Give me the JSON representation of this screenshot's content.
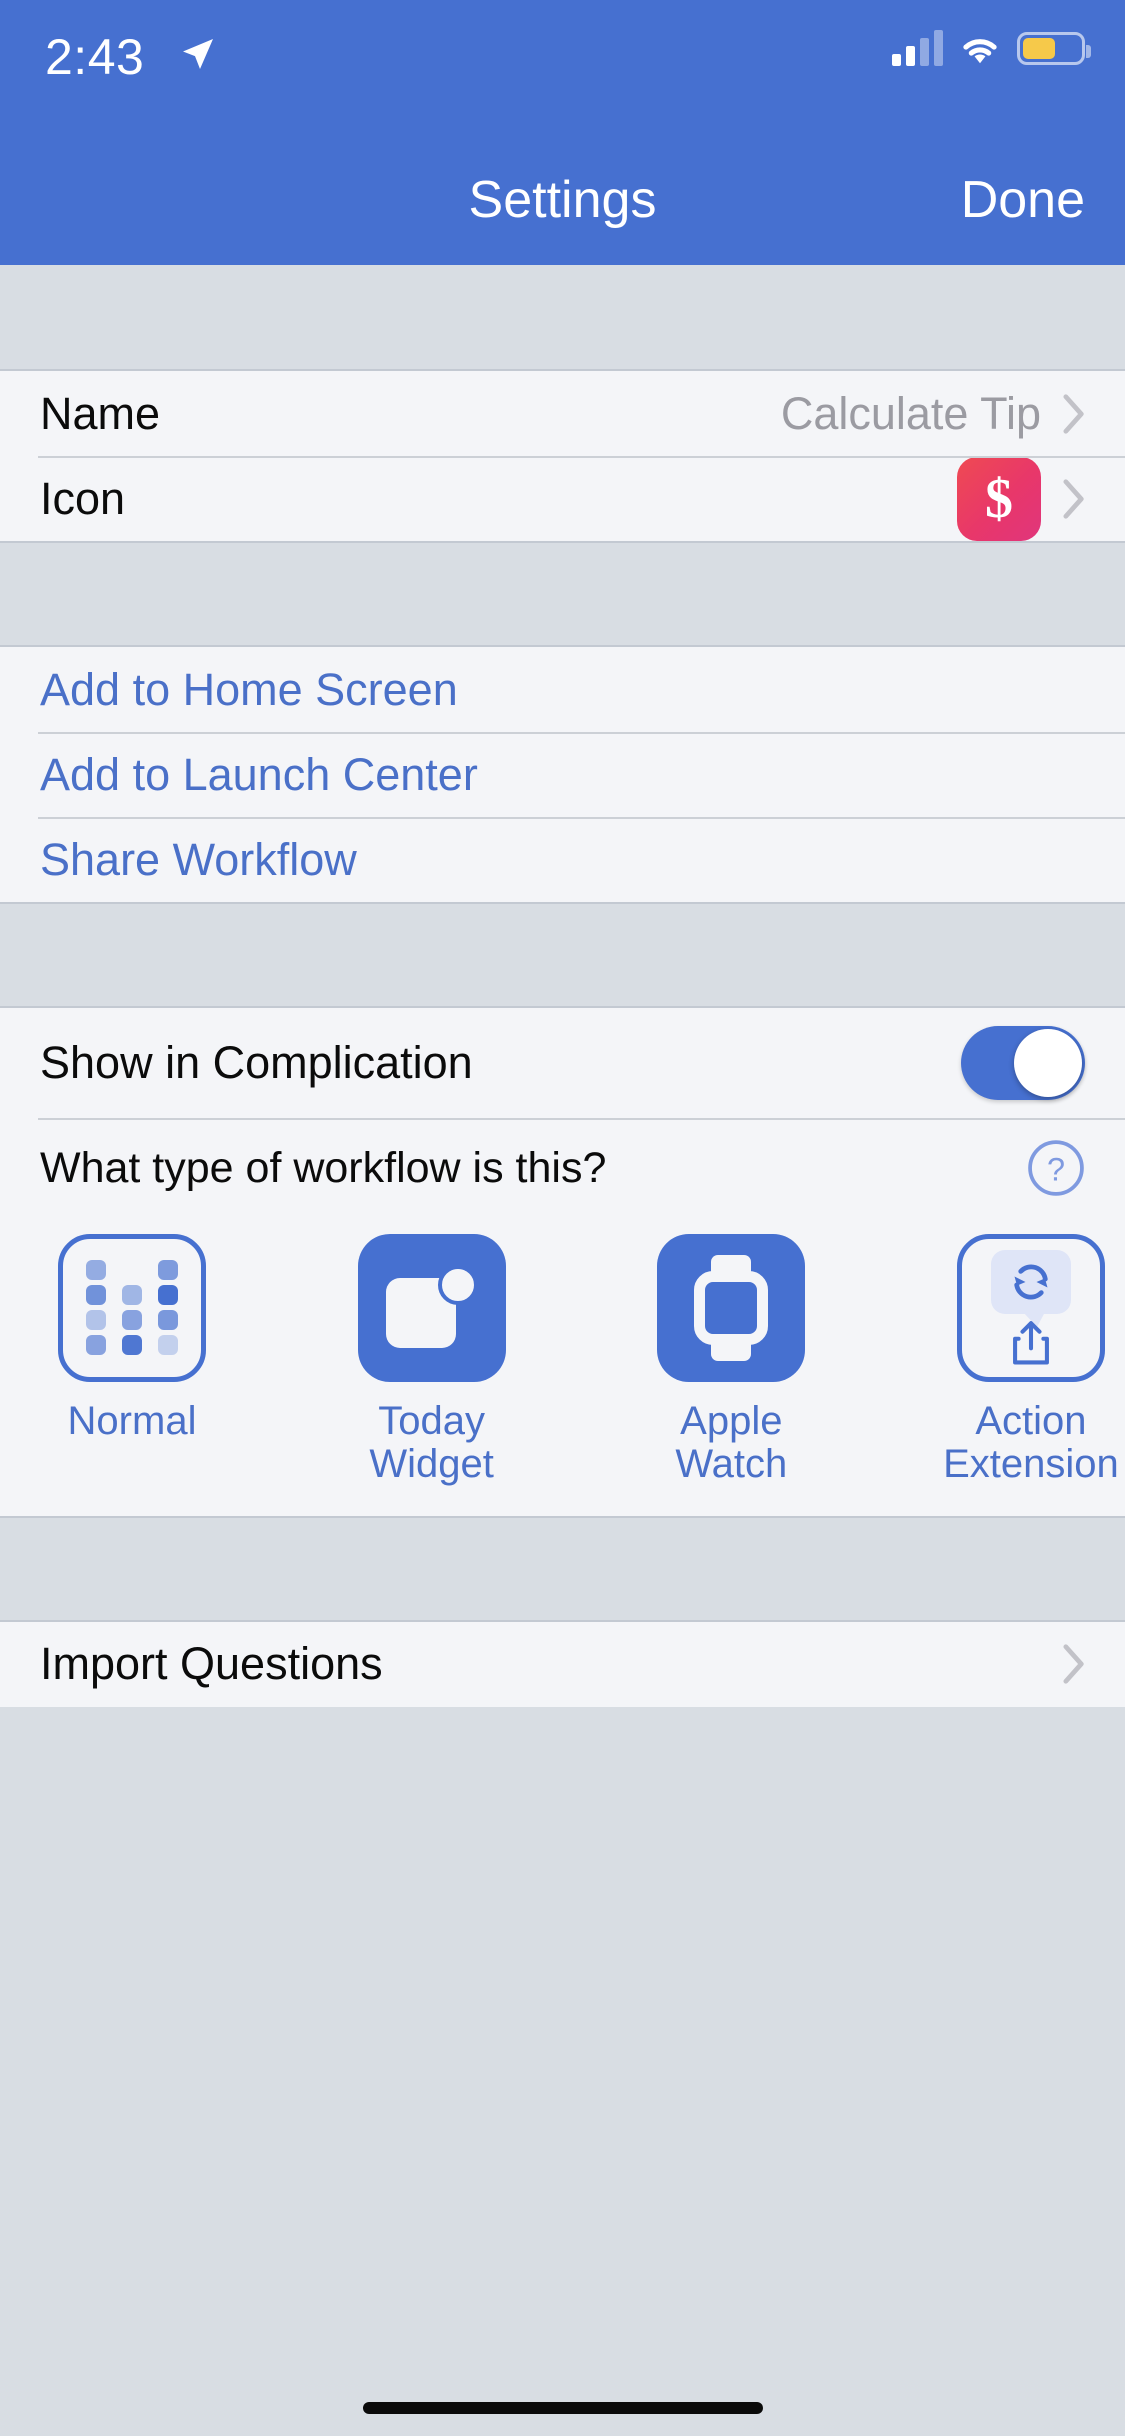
{
  "status_bar": {
    "time": "2:43",
    "location_icon": "location-arrow-icon",
    "signal_icon": "cellular-signal-icon",
    "signal_bars_filled": 2,
    "signal_bars_total": 4,
    "wifi_icon": "wifi-icon",
    "battery_icon": "battery-icon",
    "battery_color": "#f6c94a"
  },
  "nav_bar": {
    "title": "Settings",
    "done_label": "Done",
    "background_color": "#4670d0"
  },
  "sections": {
    "details": {
      "name_row": {
        "label": "Name",
        "value": "Calculate Tip",
        "chevron_icon": "chevron-right-icon"
      },
      "icon_row": {
        "label": "Icon",
        "icon_glyph": "$",
        "icon_name": "dollar-sign-icon",
        "icon_color": "#e8376a",
        "chevron_icon": "chevron-right-icon"
      }
    },
    "actions": {
      "items": [
        {
          "label": "Add to Home Screen"
        },
        {
          "label": "Add to Launch Center"
        },
        {
          "label": "Share Workflow"
        }
      ]
    },
    "workflow_type": {
      "complication_row": {
        "label": "Show in Complication",
        "toggle_state": "on",
        "toggle_color": "#4670d0"
      },
      "question": {
        "label": "What type of workflow is this?",
        "help_icon": "question-mark-circle-icon"
      },
      "types": [
        {
          "label": "Normal",
          "icon_name": "workflow-dots-icon",
          "selected": true
        },
        {
          "label": "Today\nWidget",
          "icon_name": "today-widget-icon",
          "selected": false
        },
        {
          "label": "Apple\nWatch",
          "icon_name": "apple-watch-icon",
          "selected": false
        },
        {
          "label": "Action\nExtension",
          "icon_name": "action-extension-icon",
          "selected": true
        }
      ]
    },
    "import": {
      "row": {
        "label": "Import Questions",
        "chevron_icon": "chevron-right-icon"
      }
    }
  },
  "home_indicator": "home-indicator"
}
